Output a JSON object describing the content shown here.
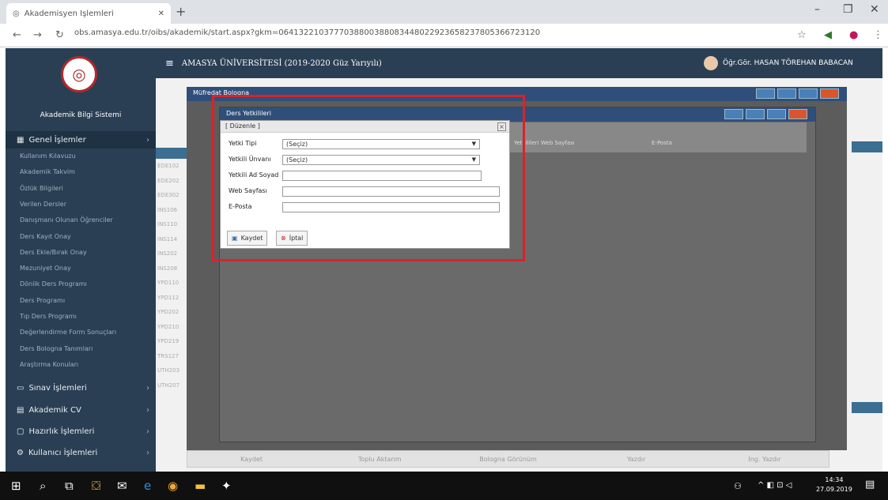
{
  "browser": {
    "tab_title": "Akademisyen İşlemleri",
    "url": "obs.amasya.edu.tr/oibs/akademik/start.aspx?gkm=0641322103777038800388083448022923658237805366723120",
    "url_host": "obs.amasya.edu.tr",
    "new_tab": "+",
    "minimize": "–",
    "maximize": "❐",
    "close": "✕"
  },
  "sidebar": {
    "brand": "Akademik Bilgi Sistemi",
    "groups": [
      {
        "label": "Genel İşlemler"
      },
      {
        "label": "Sınav İşlemleri"
      },
      {
        "label": "Akademik CV"
      },
      {
        "label": "Hazırlık İşlemleri"
      },
      {
        "label": "Kullanıcı İşlemleri"
      }
    ],
    "items": [
      "Kullanım Kılavuzu",
      "Akademik Takvim",
      "Özlük Bilgileri",
      "Verilen Dersler",
      "Danışmanı Olunan Öğrenciler",
      "Ders Kayıt Onay",
      "Ders Ekle/Bırak Onay",
      "Mezuniyet Onay",
      "Dönlik Ders Programı",
      "Ders Programı",
      "Tıp Ders Programı",
      "Değerlendirme Form Sonuçları",
      "Ders Bologna Tanımları",
      "Araştırma Konuları"
    ]
  },
  "topbar": {
    "menu_icon": "≡",
    "title": "AMASYA ÜNİVERSİTESİ (2019-2020 Güz Yarıyılı)",
    "user": "Öğr.Gör. HASAN TÖREHAN BABACAN"
  },
  "windows": {
    "outer_title": "Müfredat Bologna",
    "inner_title": "Ders Yetkilileri",
    "table_headers": [
      "Yetkilileri",
      "Web Sayfası",
      "E-Posta"
    ]
  },
  "dialog": {
    "title": "[ Düzenle ]",
    "fields": {
      "type_label": "Yetki Tipi",
      "type_value": "(Seçiz)",
      "title_label": "Yetkili Ünvanı",
      "title_value": "(Seçiz)",
      "name_label": "Yetkili Ad Soyad",
      "web_label": "Web Sayfası",
      "email_label": "E-Posta"
    },
    "save_label": "Kaydet",
    "cancel_label": "İptal"
  },
  "bottom_toolbar": [
    "Kaydet",
    "Toplu Aktarım",
    "Bologna Görünüm",
    "Yazdır",
    "İng. Yazdır"
  ],
  "bg_codes": [
    "EDE102",
    "EDE202",
    "EDE302",
    "INS106",
    "INS110",
    "INS114",
    "INS202",
    "INS208",
    "YPD110",
    "YPD112",
    "YPD202",
    "YPD210",
    "YPD219",
    "TRS127",
    "UTH203",
    "UTH207"
  ],
  "taskbar": {
    "time": "14:34",
    "date": "27.09.2019"
  },
  "colors": {
    "sidebar": "#2a3f54",
    "highlight": "#d8232a",
    "window_header": "#2f4f7a"
  }
}
